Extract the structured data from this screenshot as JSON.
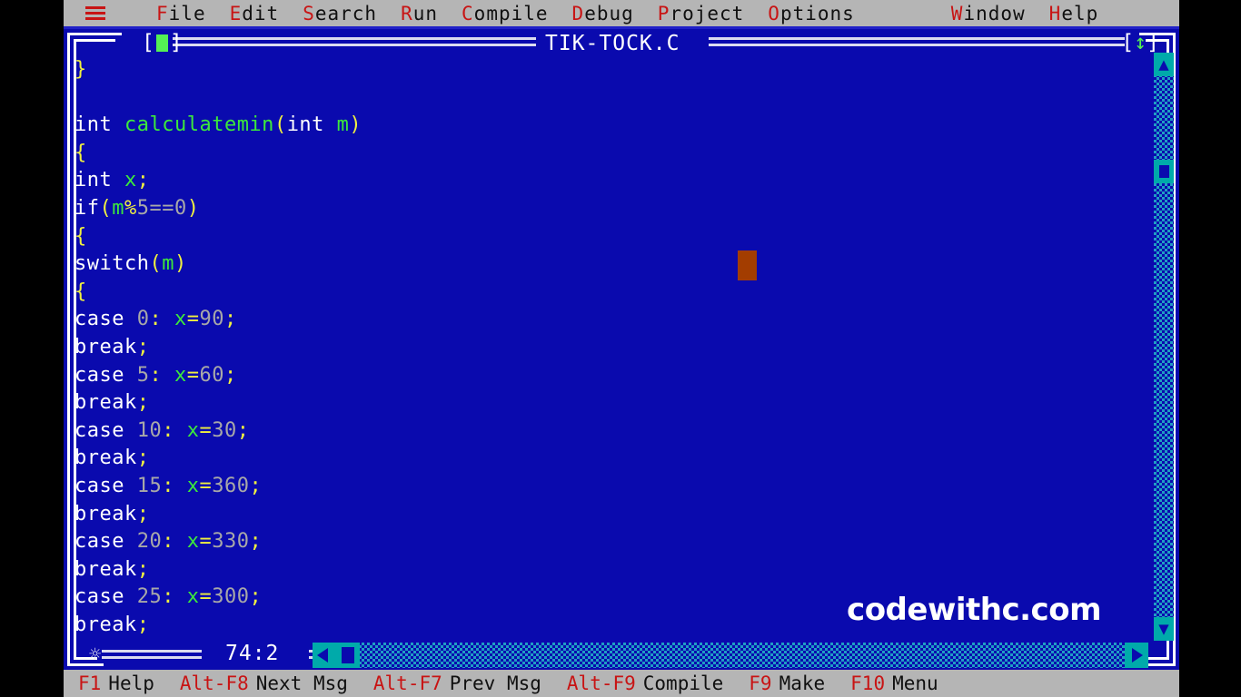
{
  "menubar": {
    "system_icon": "hamburger-icon",
    "items": [
      {
        "label": "File",
        "hotkey": "F"
      },
      {
        "label": "Edit",
        "hotkey": "E"
      },
      {
        "label": "Search",
        "hotkey": "S"
      },
      {
        "label": "Run",
        "hotkey": "R"
      },
      {
        "label": "Compile",
        "hotkey": "C"
      },
      {
        "label": "Debug",
        "hotkey": "D"
      },
      {
        "label": "Project",
        "hotkey": "P"
      },
      {
        "label": "Options",
        "hotkey": "O"
      }
    ],
    "right_items": [
      {
        "label": "Window",
        "hotkey": "W"
      },
      {
        "label": "Help",
        "hotkey": "H"
      }
    ]
  },
  "window": {
    "title": "TIK-TOCK.C",
    "close_box": "[■]",
    "zoom_box": "[↕]",
    "status": {
      "cursor_position": "74:2"
    },
    "scrollbars": {
      "vertical_up_arrow": "▲",
      "vertical_down_arrow": "▼",
      "horizontal_left_arrow": "◀",
      "horizontal_right_arrow": "▶"
    }
  },
  "editor": {
    "lines": [
      [
        {
          "t": "}",
          "c": "pu"
        }
      ],
      [],
      [
        {
          "t": "int ",
          "c": "kw"
        },
        {
          "t": "calculatemin",
          "c": "id"
        },
        {
          "t": "(",
          "c": "pu"
        },
        {
          "t": "int ",
          "c": "kw"
        },
        {
          "t": "m",
          "c": "id"
        },
        {
          "t": ")",
          "c": "pu"
        }
      ],
      [
        {
          "t": "{",
          "c": "pu"
        }
      ],
      [
        {
          "t": "int ",
          "c": "kw"
        },
        {
          "t": "x",
          "c": "id"
        },
        {
          "t": ";",
          "c": "pu"
        }
      ],
      [
        {
          "t": "if",
          "c": "kw"
        },
        {
          "t": "(",
          "c": "pu"
        },
        {
          "t": "m",
          "c": "id"
        },
        {
          "t": "%",
          "c": "pu"
        },
        {
          "t": "5",
          "c": "nu"
        },
        {
          "t": "==",
          "c": "nu"
        },
        {
          "t": "0",
          "c": "nu"
        },
        {
          "t": ")",
          "c": "pu"
        }
      ],
      [
        {
          "t": "{",
          "c": "pu"
        }
      ],
      [
        {
          "t": "switch",
          "c": "kw"
        },
        {
          "t": "(",
          "c": "pu"
        },
        {
          "t": "m",
          "c": "id"
        },
        {
          "t": ")",
          "c": "pu"
        }
      ],
      [
        {
          "t": "{",
          "c": "pu"
        }
      ],
      [
        {
          "t": "case ",
          "c": "kw"
        },
        {
          "t": "0",
          "c": "nu"
        },
        {
          "t": ":",
          "c": "pu"
        },
        {
          "t": " ",
          "c": "kw"
        },
        {
          "t": "x",
          "c": "id"
        },
        {
          "t": "=",
          "c": "pu"
        },
        {
          "t": "90",
          "c": "nu"
        },
        {
          "t": ";",
          "c": "pu"
        }
      ],
      [
        {
          "t": "break",
          "c": "kw"
        },
        {
          "t": ";",
          "c": "pu"
        }
      ],
      [
        {
          "t": "case ",
          "c": "kw"
        },
        {
          "t": "5",
          "c": "nu"
        },
        {
          "t": ":",
          "c": "pu"
        },
        {
          "t": " ",
          "c": "kw"
        },
        {
          "t": "x",
          "c": "id"
        },
        {
          "t": "=",
          "c": "pu"
        },
        {
          "t": "60",
          "c": "nu"
        },
        {
          "t": ";",
          "c": "pu"
        }
      ],
      [
        {
          "t": "break",
          "c": "kw"
        },
        {
          "t": ";",
          "c": "pu"
        }
      ],
      [
        {
          "t": "case ",
          "c": "kw"
        },
        {
          "t": "10",
          "c": "nu"
        },
        {
          "t": ":",
          "c": "pu"
        },
        {
          "t": " ",
          "c": "kw"
        },
        {
          "t": "x",
          "c": "id"
        },
        {
          "t": "=",
          "c": "pu"
        },
        {
          "t": "30",
          "c": "nu"
        },
        {
          "t": ";",
          "c": "pu"
        }
      ],
      [
        {
          "t": "break",
          "c": "kw"
        },
        {
          "t": ";",
          "c": "pu"
        }
      ],
      [
        {
          "t": "case ",
          "c": "kw"
        },
        {
          "t": "15",
          "c": "nu"
        },
        {
          "t": ":",
          "c": "pu"
        },
        {
          "t": " ",
          "c": "kw"
        },
        {
          "t": "x",
          "c": "id"
        },
        {
          "t": "=",
          "c": "pu"
        },
        {
          "t": "360",
          "c": "nu"
        },
        {
          "t": ";",
          "c": "pu"
        }
      ],
      [
        {
          "t": "break",
          "c": "kw"
        },
        {
          "t": ";",
          "c": "pu"
        }
      ],
      [
        {
          "t": "case ",
          "c": "kw"
        },
        {
          "t": "20",
          "c": "nu"
        },
        {
          "t": ":",
          "c": "pu"
        },
        {
          "t": " ",
          "c": "kw"
        },
        {
          "t": "x",
          "c": "id"
        },
        {
          "t": "=",
          "c": "pu"
        },
        {
          "t": "330",
          "c": "nu"
        },
        {
          "t": ";",
          "c": "pu"
        }
      ],
      [
        {
          "t": "break",
          "c": "kw"
        },
        {
          "t": ";",
          "c": "pu"
        }
      ],
      [
        {
          "t": "case ",
          "c": "kw"
        },
        {
          "t": "25",
          "c": "nu"
        },
        {
          "t": ":",
          "c": "pu"
        },
        {
          "t": " ",
          "c": "kw"
        },
        {
          "t": "x",
          "c": "id"
        },
        {
          "t": "=",
          "c": "pu"
        },
        {
          "t": "300",
          "c": "nu"
        },
        {
          "t": ";",
          "c": "pu"
        }
      ],
      [
        {
          "t": "break",
          "c": "kw"
        },
        {
          "t": ";",
          "c": "pu"
        }
      ]
    ]
  },
  "watermark": {
    "text": "codewithc.com"
  },
  "fkeybar": [
    {
      "key": "F1",
      "label": "Help"
    },
    {
      "key": "Alt-F8",
      "label": "Next Msg"
    },
    {
      "key": "Alt-F7",
      "label": "Prev Msg"
    },
    {
      "key": "Alt-F9",
      "label": "Compile"
    },
    {
      "key": "F9",
      "label": "Make"
    },
    {
      "key": "F10",
      "label": "Menu"
    }
  ],
  "colors": {
    "editor_background": "#0a0aae",
    "menubar_background": "#b5b5b5",
    "hotkey_red": "#c81414",
    "keyword_white": "#ffffff",
    "identifier_green": "#3ce83c",
    "punctuation_yellow": "#f0f040",
    "number_gray": "#a8a8a8",
    "scrollbar_teal": "#00aaaa",
    "cursor_orange": "#a33d00"
  }
}
